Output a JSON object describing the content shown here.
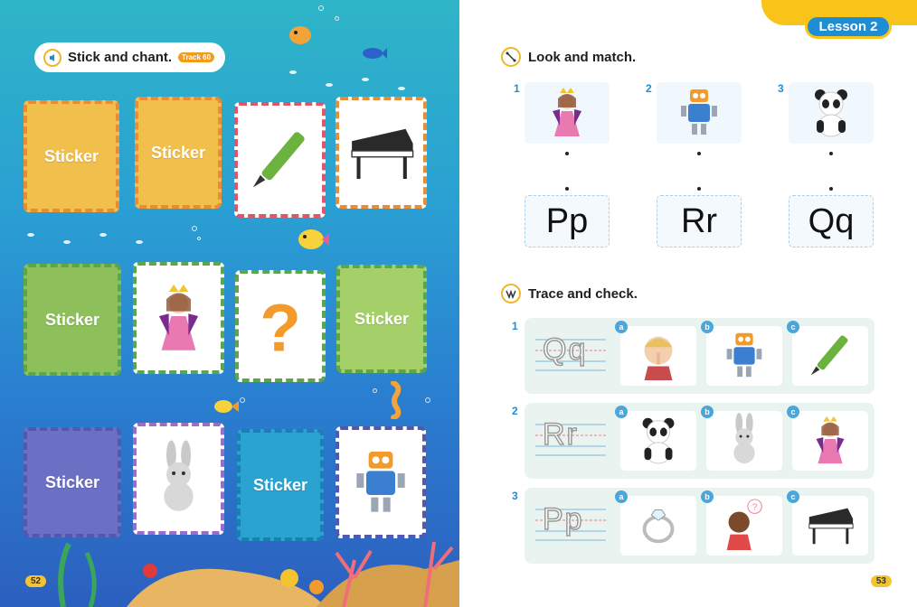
{
  "left_page": {
    "title": "Stick and chant.",
    "track": "Track 60",
    "page_number": "52",
    "cards": [
      {
        "type": "sticker",
        "label": "Sticker",
        "color": "#f1bf4b",
        "border": "#ea8b35"
      },
      {
        "type": "sticker",
        "label": "Sticker",
        "color": "#f1bf4b",
        "border": "#ea8b35"
      },
      {
        "type": "image",
        "icon": "pen-icon",
        "border": "#e0556a"
      },
      {
        "type": "image",
        "icon": "piano-icon",
        "border": "#ea8b35"
      },
      {
        "type": "sticker",
        "label": "Sticker",
        "color": "#8dc05a",
        "border": "#5aa74b"
      },
      {
        "type": "image",
        "icon": "queen-icon",
        "border": "#5aa74b"
      },
      {
        "type": "image",
        "icon": "question-mark-icon",
        "border": "#5aa74b"
      },
      {
        "type": "sticker",
        "label": "Sticker",
        "color": "#a5cf68",
        "border": "#5aa74b"
      },
      {
        "type": "sticker",
        "label": "Sticker",
        "color": "#6b70c4",
        "border": "#5058b0"
      },
      {
        "type": "image",
        "icon": "rabbit-icon",
        "border": "#9c6cc8"
      },
      {
        "type": "sticker",
        "label": "Sticker",
        "color": "#2aa3d0",
        "border": "#1b7fb3"
      },
      {
        "type": "image",
        "icon": "robot-icon",
        "border": "#5058b0"
      }
    ]
  },
  "right_page": {
    "lesson": "Lesson 2",
    "page_number": "53",
    "section1": {
      "title": "Look and match.",
      "items": [
        {
          "num": "1",
          "icon": "queen-icon"
        },
        {
          "num": "2",
          "icon": "robot-icon"
        },
        {
          "num": "3",
          "icon": "panda-icon"
        }
      ],
      "letters": [
        "Pp",
        "Rr",
        "Qq"
      ]
    },
    "section2": {
      "title": "Trace and check.",
      "rows": [
        {
          "num": "1",
          "trace": "Qq",
          "options": [
            {
              "label": "a",
              "icon": "boy-shush-icon"
            },
            {
              "label": "b",
              "icon": "robot-icon"
            },
            {
              "label": "c",
              "icon": "pen-icon"
            }
          ]
        },
        {
          "num": "2",
          "trace": "Rr",
          "options": [
            {
              "label": "a",
              "icon": "panda-icon"
            },
            {
              "label": "b",
              "icon": "rabbit-icon"
            },
            {
              "label": "c",
              "icon": "queen-icon"
            }
          ]
        },
        {
          "num": "3",
          "trace": "Pp",
          "options": [
            {
              "label": "a",
              "icon": "ring-icon"
            },
            {
              "label": "b",
              "icon": "girl-question-icon"
            },
            {
              "label": "c",
              "icon": "piano-icon"
            }
          ]
        }
      ]
    }
  }
}
